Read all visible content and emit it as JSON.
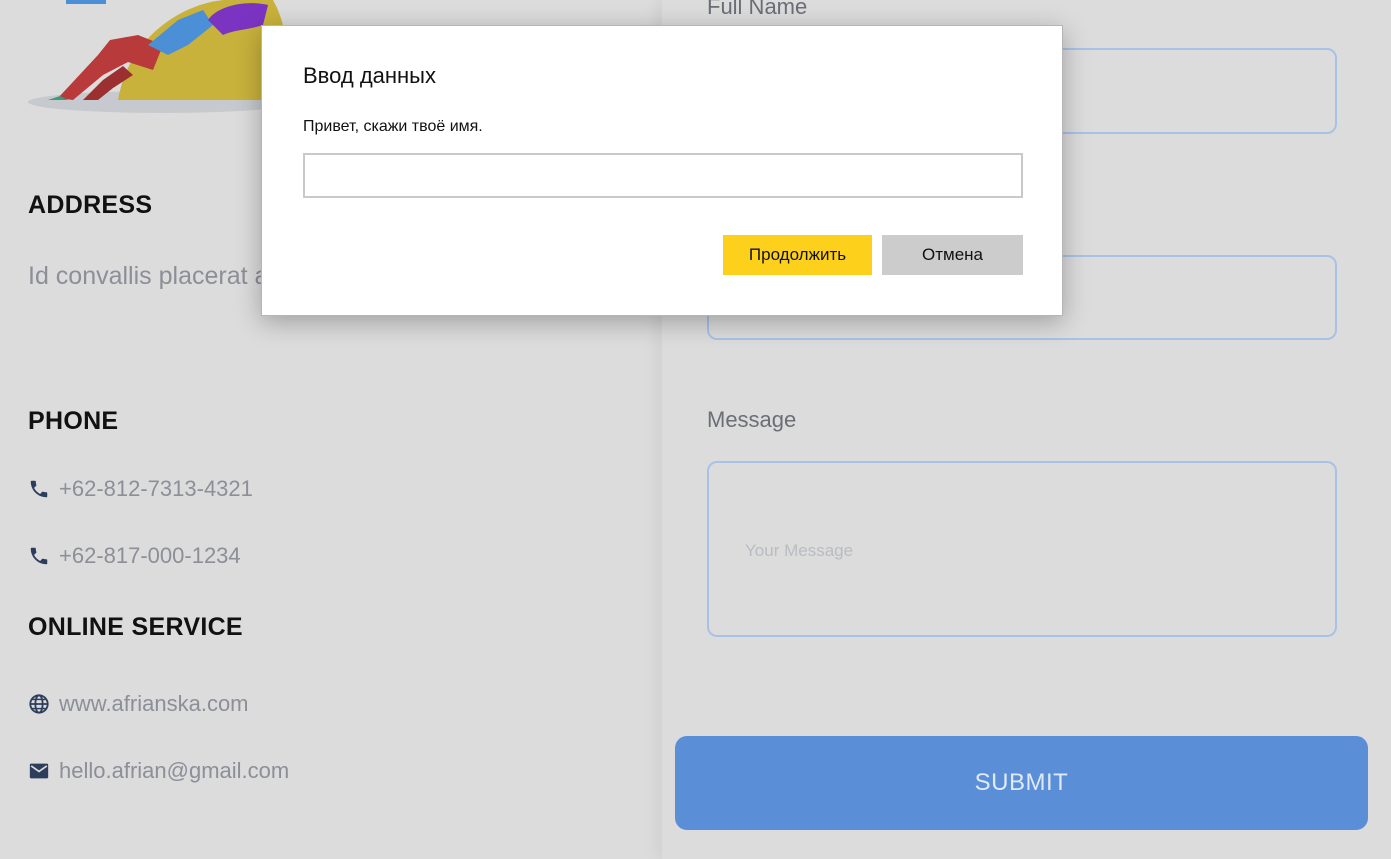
{
  "left": {
    "address": {
      "heading": "ADDRESS",
      "text": "Id convallis placerat amet volutpat quam a, pharetra."
    },
    "phone": {
      "heading": "PHONE",
      "numbers": [
        "+62-812-7313-4321",
        "+62-817-000-1234"
      ]
    },
    "online": {
      "heading": "ONLINE SERVICE",
      "website": "www.afrianska.com",
      "email": "hello.afrian@gmail.com"
    },
    "icons": {
      "phone": "phone-icon",
      "globe": "globe-icon",
      "mail": "mail-icon"
    }
  },
  "form": {
    "full_name_label": "Full Name",
    "full_name_value": "",
    "second_field_value": "",
    "message_label": "Message",
    "message_placeholder": "Your Message",
    "submit_label": "SUBMIT"
  },
  "dialog": {
    "title": "Ввод данных",
    "message": "Привет, скажи твоё имя.",
    "input_value": "",
    "continue_label": "Продолжить",
    "cancel_label": "Отмена"
  },
  "colors": {
    "overlay_background": "#dcdcdc",
    "accent_blue": "#5a8fd8",
    "input_border": "#a8c2e6",
    "continue_button": "#fdd11b",
    "cancel_button": "#cccccc",
    "icon_navy": "#2c3e5c"
  }
}
